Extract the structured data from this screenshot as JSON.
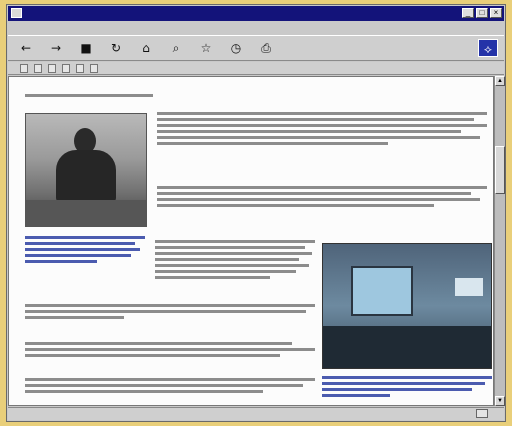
{
  "window": {
    "title": "",
    "menu": [
      "",
      "",
      "",
      "",
      ""
    ]
  },
  "toolbar": {
    "tool_icons": [
      "back-icon",
      "forward-icon",
      "stop-icon",
      "refresh-icon",
      "home-icon",
      "search-icon",
      "favorites-icon",
      "history-icon",
      "print-icon"
    ],
    "throbber_icon": "browser-logo-icon"
  },
  "linkbar": {
    "links": [
      "",
      "",
      "",
      "",
      "",
      ""
    ]
  },
  "status": {
    "text": ""
  },
  "article": {
    "heading": "",
    "caption_left": "",
    "caption_right": ""
  },
  "colors": {
    "titlebar": "#13137a",
    "link_blue": "#2b3ea1",
    "background_frame": "#e9cf7a"
  }
}
